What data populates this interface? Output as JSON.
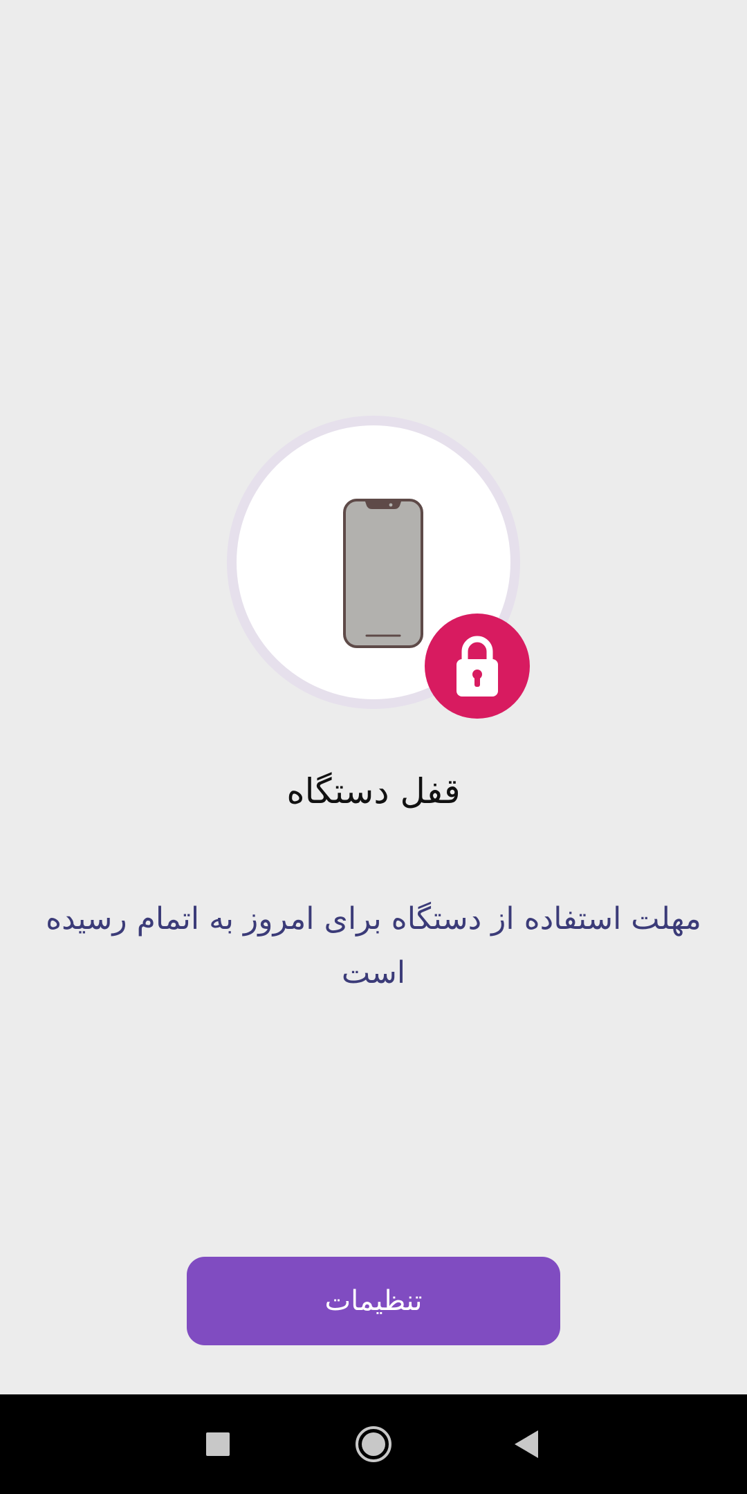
{
  "lock_screen": {
    "title": "قفل دستگاه",
    "message": "مهلت استفاده از دستگاه برای امروز به اتمام رسیده است",
    "settings_button_label": "تنظیمات",
    "icons": {
      "device": "smartphone-icon",
      "badge": "lock-icon"
    }
  },
  "navigation": {
    "buttons": [
      "recents-icon",
      "home-icon",
      "back-icon"
    ]
  },
  "colors": {
    "background": "#ececec",
    "primary": "#804cc1",
    "lock_badge": "#d81b60",
    "message_text": "#3b3b78",
    "title_text": "#111111",
    "nav_bar": "#000000"
  }
}
